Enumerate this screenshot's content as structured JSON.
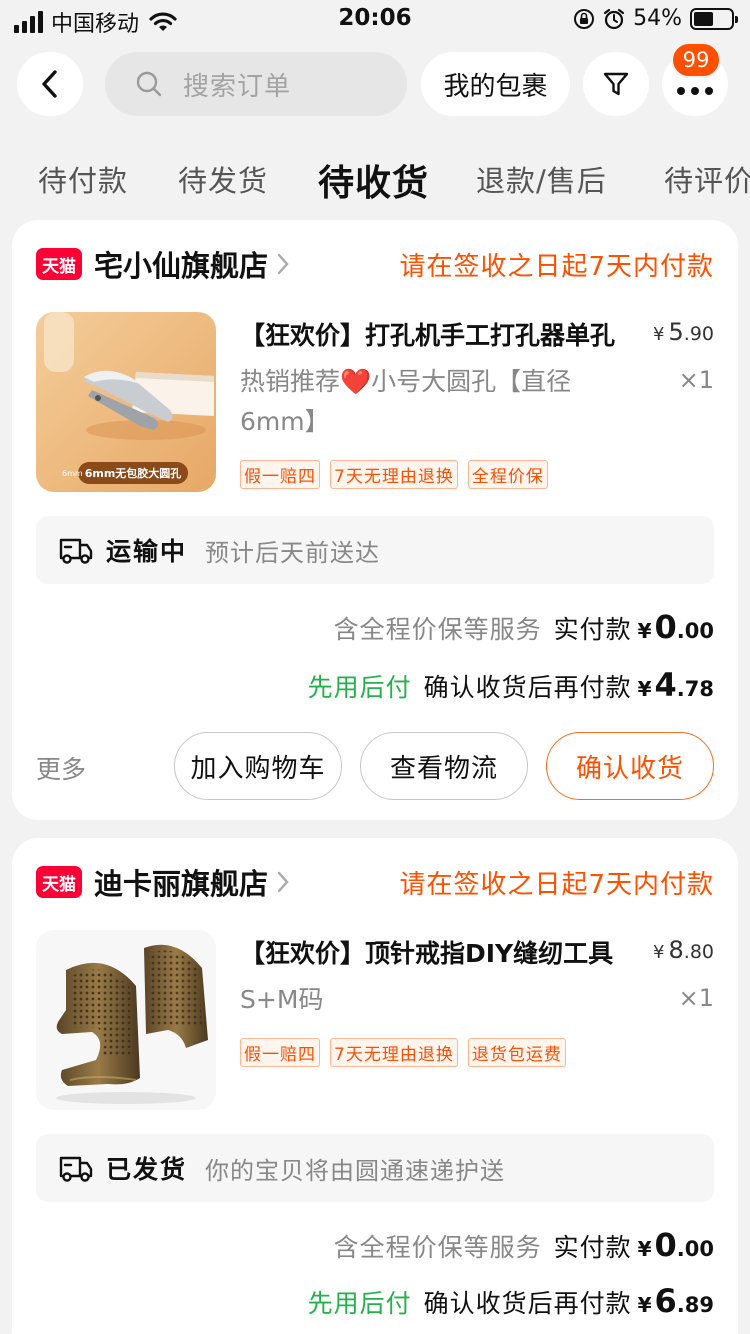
{
  "status_bar": {
    "carrier": "中国移动",
    "time": "20:06",
    "battery_pct": "54%",
    "battery_level": 0.54
  },
  "nav": {
    "search_placeholder": "搜索订单",
    "packages_label": "我的包裹",
    "badge_count": "99"
  },
  "tabs": [
    {
      "label": "待付款",
      "active": false
    },
    {
      "label": "待发货",
      "active": false
    },
    {
      "label": "待收货",
      "active": true
    },
    {
      "label": "退款/售后",
      "active": false
    },
    {
      "label": "待评价",
      "active": false
    }
  ],
  "orders": [
    {
      "store_badge": "天猫",
      "store_name": "宅小仙旗舰店",
      "pay_note": "请在签收之日起7天内付款",
      "product": {
        "title": "【狂欢价】打孔机手工打孔器单孔",
        "price_symbol": "¥",
        "price_int": "5",
        "price_dec": ".90",
        "spec": "热销推荐❤️小号大圆孔【直径6mm】",
        "qty": "×1",
        "thumb_caption": "6mm无包胶大圆孔",
        "thumb_small": "6mm",
        "tags": [
          "假一赔四",
          "7天无理由退换",
          "全程价保"
        ]
      },
      "shipping": {
        "status": "运输中",
        "desc": "预计后天前送达"
      },
      "service_note": "含全程价保等服务",
      "paid_label": "实付款",
      "paid_int": "0",
      "paid_dec": ".00",
      "later_pay_label": "先用后付",
      "later_desc": "确认收货后再付款",
      "later_int": "4",
      "later_dec": ".78",
      "more_label": "更多",
      "buttons": {
        "cart": "加入购物车",
        "logistics": "查看物流",
        "confirm": "确认收货"
      }
    },
    {
      "store_badge": "天猫",
      "store_name": "迪卡丽旗舰店",
      "pay_note": "请在签收之日起7天内付款",
      "product": {
        "title": "【狂欢价】顶针戒指DIY缝纫工具",
        "price_symbol": "¥",
        "price_int": "8",
        "price_dec": ".80",
        "spec": "S+M码",
        "qty": "×1",
        "tags": [
          "假一赔四",
          "7天无理由退换",
          "退货包运费"
        ]
      },
      "shipping": {
        "status": "已发货",
        "desc": "你的宝贝将由圆通速递护送"
      },
      "service_note": "含全程价保等服务",
      "paid_label": "实付款",
      "paid_int": "0",
      "paid_dec": ".00",
      "later_pay_label": "先用后付",
      "later_desc": "确认收货后再付款",
      "later_int": "6",
      "later_dec": ".89"
    }
  ]
}
